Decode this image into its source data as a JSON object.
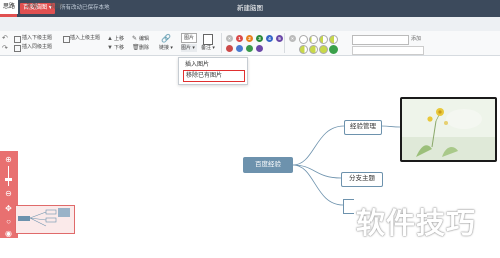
{
  "titlebar": {
    "app_button": "百度脑图 ▾",
    "save_status": "所有改动已保存本地",
    "doc_title": "新建脑图"
  },
  "tabs": [
    {
      "label": "思路",
      "active": true
    },
    {
      "label": "外观",
      "active": false
    },
    {
      "label": "视图",
      "active": false
    }
  ],
  "toolbar": {
    "insert_child": "插入下级主题",
    "insert_parent": "插入上级主题",
    "insert_sibling": "插入同级主题",
    "move_up": "上移",
    "move_down": "下移",
    "edit": "编辑",
    "delete": "删除",
    "link": "链接 ▾",
    "image": "图片",
    "image_dropdown": "图片 ▾",
    "note": "备注 ▾",
    "priority_labels": [
      "1",
      "2",
      "3",
      "4",
      "5"
    ],
    "priority_colors": [
      "#d94a4a",
      "#e8811f",
      "#2a8a3a",
      "#3566c8",
      "#6b48a8"
    ],
    "add_button": "添加"
  },
  "dropdown": {
    "insert_image": "插入图片",
    "remove_image": "移除已有图片"
  },
  "mindmap": {
    "root": "百度经验",
    "child_experience": "经验管理",
    "child_branch": "分支主题"
  },
  "watermark": "软件技巧"
}
